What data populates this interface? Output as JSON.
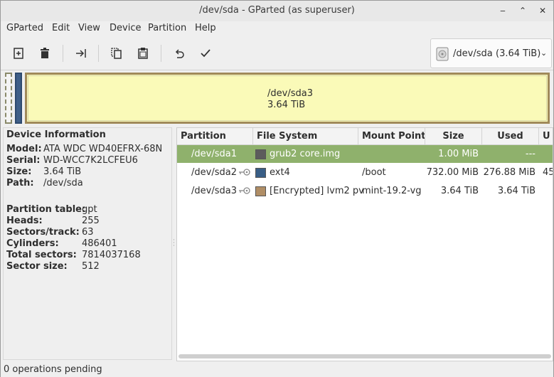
{
  "window": {
    "title": "/dev/sda - GParted (as superuser)",
    "minimize_glyph": "‒",
    "maximize_glyph": "⌃",
    "close_glyph": "✕"
  },
  "menu": [
    "GParted",
    "Edit",
    "View",
    "Device",
    "Partition",
    "Help"
  ],
  "toolbar": {
    "buttons": [
      "new-icon",
      "delete-icon",
      "resize-move-icon",
      "copy-icon",
      "paste-icon",
      "undo-icon",
      "apply-icon"
    ],
    "device_selector": {
      "device": "/dev/sda",
      "size": "(3.64 TiB)",
      "chevron": "⌄",
      "icon": "harddisk-icon"
    }
  },
  "partition_bar": {
    "main_label_name": "/dev/sda3",
    "main_label_size": "3.64 TiB"
  },
  "device_info": {
    "title": "Device Information",
    "general": [
      {
        "label": "Model:",
        "value": "ATA WDC WD40EFRX-68N"
      },
      {
        "label": "Serial:",
        "value": "WD-WCC7K2LCFEU6"
      },
      {
        "label": "Size:",
        "value": "3.64 TiB"
      },
      {
        "label": "Path:",
        "value": "/dev/sda"
      }
    ],
    "geometry": [
      {
        "label": "Partition table:",
        "value": "gpt"
      },
      {
        "label": "Heads:",
        "value": "255"
      },
      {
        "label": "Sectors/track:",
        "value": "63"
      },
      {
        "label": "Cylinders:",
        "value": "486401"
      },
      {
        "label": "Total sectors:",
        "value": "7814037168"
      },
      {
        "label": "Sector size:",
        "value": "512"
      }
    ]
  },
  "table": {
    "columns": [
      "Partition",
      "File System",
      "Mount Point",
      "Size",
      "Used",
      "U"
    ],
    "rows": [
      {
        "partition": "/dev/sda1",
        "fs": "grub2 core.img",
        "fs_color": "#5c5c5c",
        "mount": "",
        "size": "1.00 MiB",
        "used": "---",
        "unused": "",
        "key": false,
        "selected": true
      },
      {
        "partition": "/dev/sda2",
        "fs": "ext4",
        "fs_color": "#395e86",
        "mount": "/boot",
        "size": "732.00 MiB",
        "used": "276.88 MiB",
        "unused": "45",
        "key": true,
        "selected": false
      },
      {
        "partition": "/dev/sda3",
        "fs": "[Encrypted] lvm2 pv",
        "fs_color": "#b08e66",
        "mount": "mint-19.2-vg",
        "size": "3.64 TiB",
        "used": "3.64 TiB",
        "unused": "",
        "key": true,
        "selected": false
      }
    ]
  },
  "status": {
    "text": "0 operations pending"
  },
  "colors": {
    "selection": "#8fb16c",
    "partition_fill": "#fafab8",
    "partition_border": "#a08a5a"
  }
}
